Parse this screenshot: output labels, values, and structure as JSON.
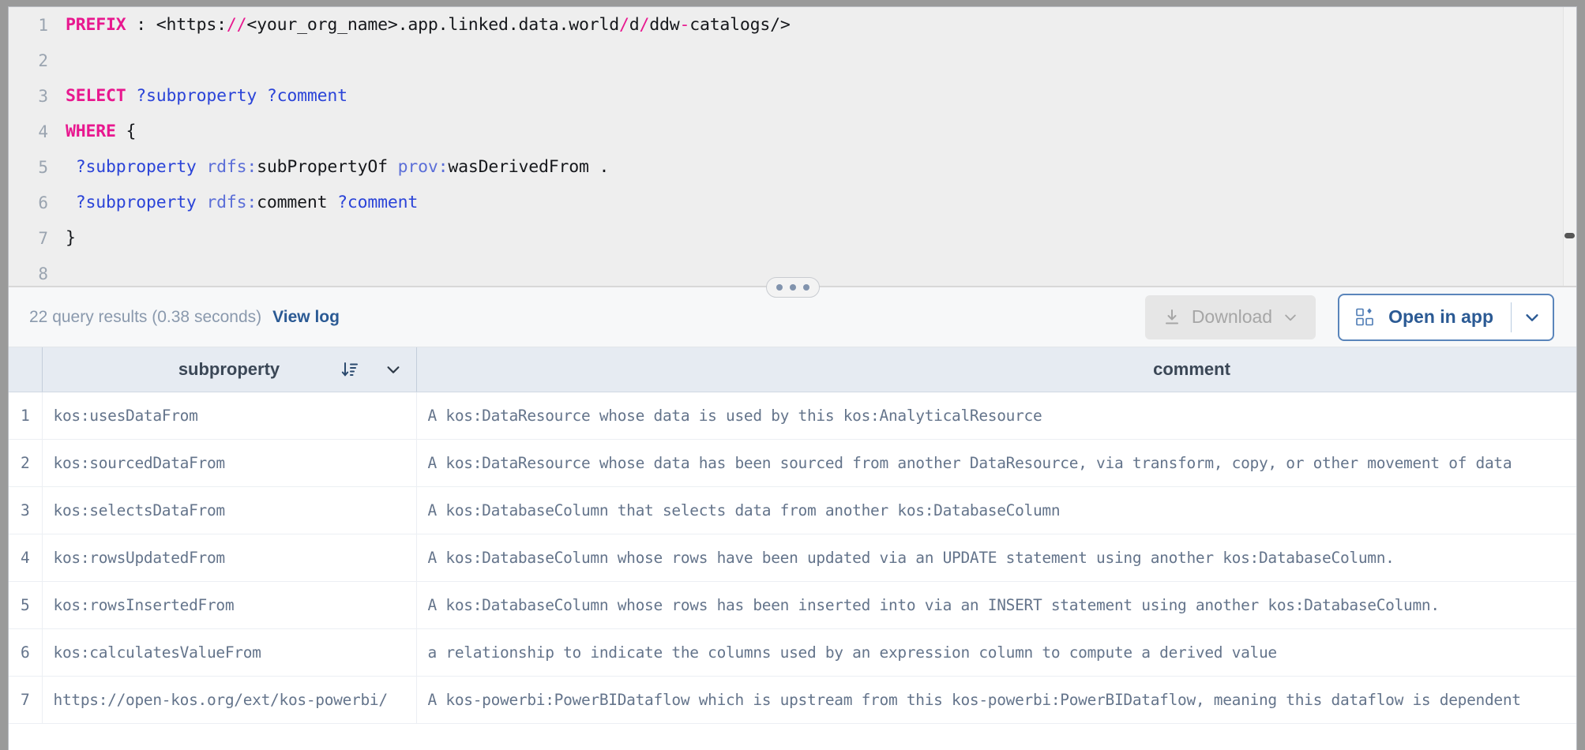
{
  "editor": {
    "lines": [
      {
        "number": "1",
        "tokens": [
          {
            "t": "PREFIX",
            "c": "kw"
          },
          {
            "t": " : ",
            "c": "plain"
          },
          {
            "t": "<https:",
            "c": "plain"
          },
          {
            "t": "//",
            "c": "pink"
          },
          {
            "t": "<your_org_name>",
            "c": "plain"
          },
          {
            "t": ".app.linked.data.world",
            "c": "plain"
          },
          {
            "t": "/",
            "c": "pink"
          },
          {
            "t": "d",
            "c": "plain"
          },
          {
            "t": "/",
            "c": "pink"
          },
          {
            "t": "ddw",
            "c": "plain"
          },
          {
            "t": "-",
            "c": "pink"
          },
          {
            "t": "catalogs/>",
            "c": "plain"
          }
        ]
      },
      {
        "number": "2",
        "tokens": []
      },
      {
        "number": "3",
        "tokens": [
          {
            "t": "SELECT",
            "c": "kw"
          },
          {
            "t": " ",
            "c": "plain"
          },
          {
            "t": "?subproperty",
            "c": "var"
          },
          {
            "t": " ",
            "c": "plain"
          },
          {
            "t": "?comment",
            "c": "var"
          }
        ]
      },
      {
        "number": "4",
        "tokens": [
          {
            "t": "WHERE",
            "c": "kw"
          },
          {
            "t": " {",
            "c": "plain"
          }
        ]
      },
      {
        "number": "5",
        "tokens": [
          {
            "t": " ",
            "c": "plain"
          },
          {
            "t": "?subproperty",
            "c": "var"
          },
          {
            "t": " ",
            "c": "plain"
          },
          {
            "t": "rdfs:",
            "c": "pfx"
          },
          {
            "t": "subPropertyOf",
            "c": "plain"
          },
          {
            "t": " ",
            "c": "plain"
          },
          {
            "t": "prov:",
            "c": "pfx"
          },
          {
            "t": "wasDerivedFrom",
            "c": "plain"
          },
          {
            "t": " .",
            "c": "plain"
          }
        ]
      },
      {
        "number": "6",
        "tokens": [
          {
            "t": " ",
            "c": "plain"
          },
          {
            "t": "?subproperty",
            "c": "var"
          },
          {
            "t": " ",
            "c": "plain"
          },
          {
            "t": "rdfs:",
            "c": "pfx"
          },
          {
            "t": "comment",
            "c": "plain"
          },
          {
            "t": " ",
            "c": "plain"
          },
          {
            "t": "?comment",
            "c": "var"
          }
        ]
      },
      {
        "number": "7",
        "tokens": [
          {
            "t": "}",
            "c": "plain"
          }
        ]
      },
      {
        "number": "8",
        "tokens": []
      }
    ]
  },
  "toolbar": {
    "status": "22 query results (0.38 seconds)",
    "result_count": 22,
    "elapsed_seconds": "0.38",
    "view_log_label": "View log",
    "download_label": "Download",
    "download_icon": "download-icon",
    "download_caret_icon": "chevron-down-icon",
    "open_in_app_label": "Open in app",
    "open_in_app_icon": "apps-grid-icon",
    "open_in_app_caret_icon": "chevron-down-icon"
  },
  "table": {
    "columns": [
      {
        "key": "subproperty",
        "label": "subproperty",
        "sort_icon": "sort-descending-icon",
        "menu_icon": "chevron-down-icon",
        "has_sort": true
      },
      {
        "key": "comment",
        "label": "comment",
        "menu_icon": "chevron-down-icon",
        "has_sort": false
      }
    ],
    "rows": [
      {
        "index": "1",
        "subproperty": "kos:usesDataFrom",
        "comment": "A kos:DataResource whose data is used by this kos:AnalyticalResource"
      },
      {
        "index": "2",
        "subproperty": "kos:sourcedDataFrom",
        "comment": "A kos:DataResource whose data has been sourced from another DataResource, via transform, copy, or other movement  of data"
      },
      {
        "index": "3",
        "subproperty": "kos:selectsDataFrom",
        "comment": "A kos:DatabaseColumn that selects  data from another kos:DatabaseColumn"
      },
      {
        "index": "4",
        "subproperty": "kos:rowsUpdatedFrom",
        "comment": "A kos:DatabaseColumn whose rows have been updated via an UPDATE statement using another kos:DatabaseColumn."
      },
      {
        "index": "5",
        "subproperty": "kos:rowsInsertedFrom",
        "comment": "A kos:DatabaseColumn whose rows has been inserted into via an INSERT statement using another kos:DatabaseColumn."
      },
      {
        "index": "6",
        "subproperty": "kos:calculatesValueFrom",
        "comment": "a relationship to indicate the columns used by an expression column to compute a derived value"
      },
      {
        "index": "7",
        "subproperty": "https://open-kos.org/ext/kos-powerbi/",
        "comment": "A kos-powerbi:PowerBIDataflow which is upstream from this kos-powerbi:PowerBIDataflow, meaning this dataflow is dependent"
      }
    ]
  },
  "colors": {
    "keyword_pink": "#e8188f",
    "variable_blue": "#2b44d8",
    "prefix_blue": "#5c6fd8",
    "link_blue": "#2b5a94",
    "accent_border": "#5a85bb",
    "editor_bg": "#eeeeee",
    "header_bg": "#e6ebf2",
    "gutter_bg": "#e9eef4",
    "cell_text": "#64748b",
    "status_text": "#8a99ad"
  }
}
